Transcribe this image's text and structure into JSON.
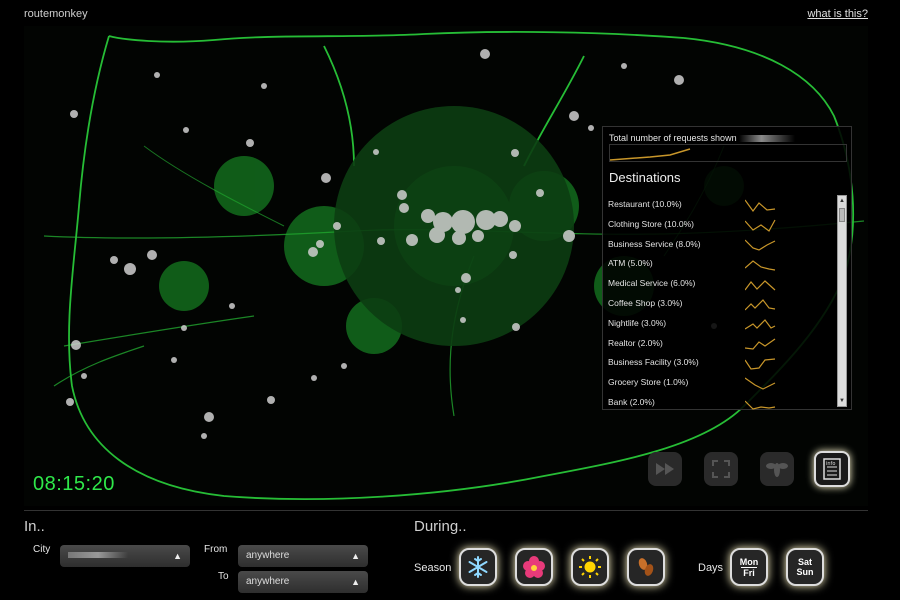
{
  "app": {
    "title": "routemonkey",
    "about_link": "what is this?"
  },
  "clock": "08:15:20",
  "panel": {
    "total_label": "Total number of requests shown",
    "destinations_title": "Destinations",
    "destinations": [
      {
        "label": "Restaurant (10.0%)"
      },
      {
        "label": "Clothing Store (10.0%)"
      },
      {
        "label": "Business Service (8.0%)"
      },
      {
        "label": "ATM (5.0%)"
      },
      {
        "label": "Medical Service (6.0%)"
      },
      {
        "label": "Coffee Shop (3.0%)"
      },
      {
        "label": "Nightlife (3.0%)"
      },
      {
        "label": "Realtor (2.0%)"
      },
      {
        "label": "Business Facility (3.0%)"
      },
      {
        "label": "Grocery Store (1.0%)"
      },
      {
        "label": "Bank (2.0%)"
      }
    ]
  },
  "controls": [
    {
      "name": "fast-forward-icon",
      "label": "fast forward"
    },
    {
      "name": "fullscreen-icon",
      "label": "fullscreen"
    },
    {
      "name": "bee-icon",
      "label": "bee"
    },
    {
      "name": "info-icon",
      "label": "info"
    }
  ],
  "location": {
    "section_title": "In..",
    "city_label": "City",
    "from_label": "From",
    "from_value": "anywhere",
    "to_label": "To",
    "to_value": "anywhere"
  },
  "time": {
    "section_title": "During..",
    "season_label": "Season",
    "seasons": [
      "winter-snowflake-icon",
      "spring-flower-icon",
      "summer-sun-icon",
      "autumn-leaves-icon"
    ],
    "days_label": "Days",
    "weekday": {
      "line1": "Mon",
      "line2": "Fri"
    },
    "weekend": {
      "line1": "Sat",
      "line2": "Sun"
    }
  },
  "colors": {
    "accent": "#2fe84a",
    "sparkline": "#c8962a"
  }
}
